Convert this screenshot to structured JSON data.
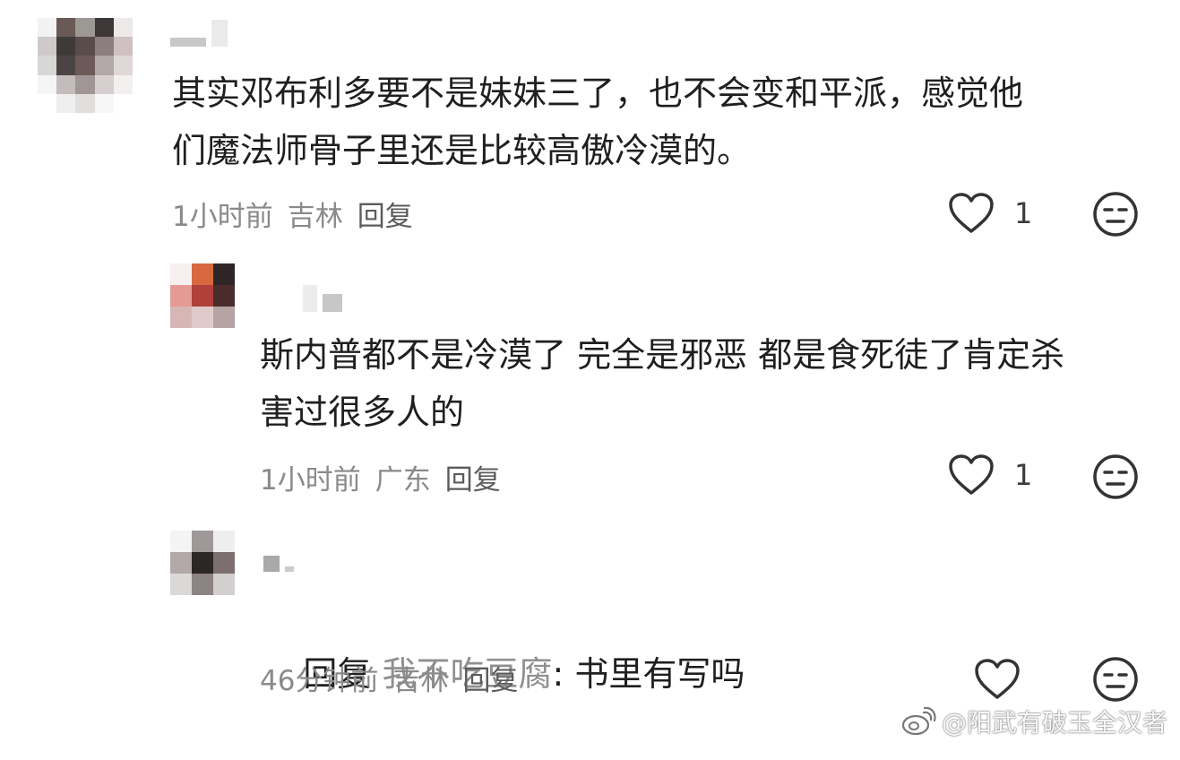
{
  "comments": [
    {
      "text": "其实邓布利多要不是妹妹三了，也不会变和平派，感觉他\n们魔法师骨子里还是比较高傲冷漠的。",
      "time": "1小时前",
      "location": "吉林",
      "reply_label": "回复",
      "like_count": "1"
    },
    {
      "text": "斯内普都不是冷漠了 完全是邪恶 都是食死徒了肯定杀\n害过很多人的",
      "time": "1小时前",
      "location": "广东",
      "reply_label": "回复",
      "like_count": "1"
    },
    {
      "reply_prefix": "回复",
      "reply_target": "我不吃豆腐",
      "text": ": 书里有写吗",
      "time": "46分钟前",
      "location": "吉林",
      "reply_label": "回复",
      "like_count": ""
    }
  ],
  "icons": {
    "like": "heart-outline-icon",
    "dislike": "neutral-face-icon",
    "watermark_logo": "weibo-icon"
  },
  "watermark": {
    "text": "@阳武有破玉全汉者"
  }
}
